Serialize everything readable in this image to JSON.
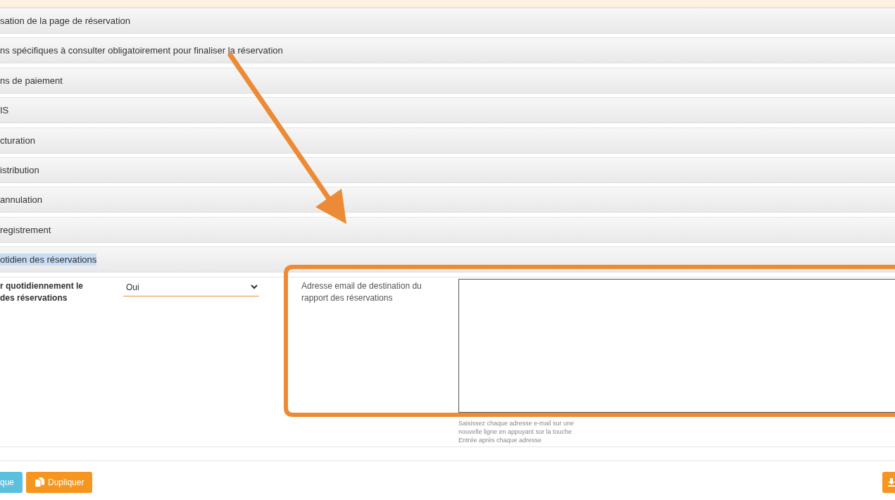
{
  "accordion": {
    "sections": [
      {
        "title": "sation de la page de réservation",
        "highlighted": false
      },
      {
        "title": "ns spécifiques à consulter obligatoirement pour finaliser la réservation",
        "highlighted": false
      },
      {
        "title": "ns de paiement",
        "highlighted": false
      },
      {
        "title": "IS",
        "highlighted": false
      },
      {
        "title": "cturation",
        "highlighted": false
      },
      {
        "title": "istribution",
        "highlighted": false
      },
      {
        "title": "annulation",
        "highlighted": false
      },
      {
        "title": "registrement",
        "highlighted": false
      },
      {
        "title": "otidien des réservations",
        "highlighted": true
      }
    ]
  },
  "report_settings": {
    "daily_report": {
      "label": "r quotidiennement le\ndes réservations",
      "value": "Oui"
    },
    "email": {
      "label": "Adresse email de destination du rapport des réservations",
      "hint": "Saisissez chaque adresse e-mail sur une nouvelle ligne en appuyant sur la touche Entrée après chaque adresse"
    }
  },
  "actions": [
    {
      "kind": "info",
      "label": "que"
    },
    {
      "kind": "duplicate",
      "label": "Dupliquer"
    },
    {
      "kind": "icon_only"
    }
  ]
}
